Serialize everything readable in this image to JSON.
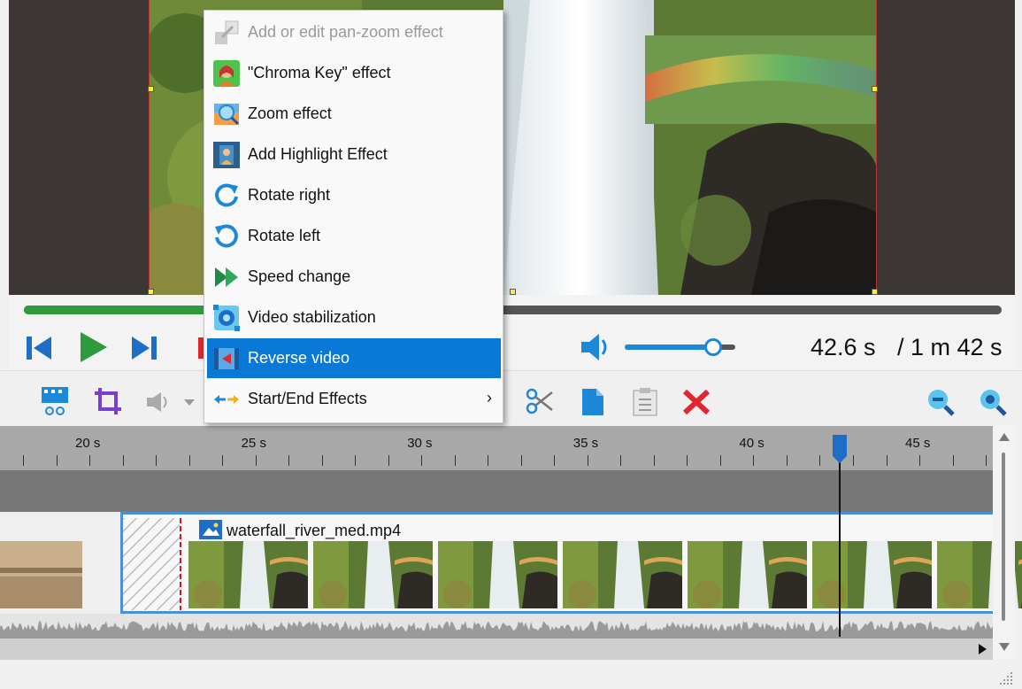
{
  "player": {
    "current_time": "42.6 s",
    "total_time": "/ 1 m 42 s",
    "progress_fraction": 0.42,
    "volume_fraction": 0.8
  },
  "context_menu": {
    "items": [
      {
        "label": "Add or edit pan-zoom effect",
        "icon": "pan-zoom-icon",
        "enabled": false
      },
      {
        "label": "\"Chroma Key\" effect",
        "icon": "chroma-key-icon",
        "enabled": true
      },
      {
        "label": "Zoom effect",
        "icon": "zoom-effect-icon",
        "enabled": true
      },
      {
        "label": "Add Highlight Effect",
        "icon": "highlight-effect-icon",
        "enabled": true
      },
      {
        "label": "Rotate right",
        "icon": "rotate-right-icon",
        "enabled": true
      },
      {
        "label": "Rotate left",
        "icon": "rotate-left-icon",
        "enabled": true
      },
      {
        "label": "Speed change",
        "icon": "speed-change-icon",
        "enabled": true
      },
      {
        "label": "Video stabilization",
        "icon": "video-stabilization-icon",
        "enabled": true
      },
      {
        "label": "Reverse video",
        "icon": "reverse-video-icon",
        "enabled": true,
        "selected": true
      },
      {
        "label": "Start/End Effects",
        "icon": "start-end-effects-icon",
        "enabled": true,
        "submenu": true
      }
    ]
  },
  "timeline": {
    "ruler_labels": [
      "20 s",
      "25 s",
      "30 s",
      "35 s",
      "40 s",
      "45 s"
    ],
    "clip_name": "waterfall_river_med.mp4"
  },
  "colors": {
    "accent": "#0a78d7",
    "progress": "#2e9a3e",
    "delete": "#e0262e"
  }
}
